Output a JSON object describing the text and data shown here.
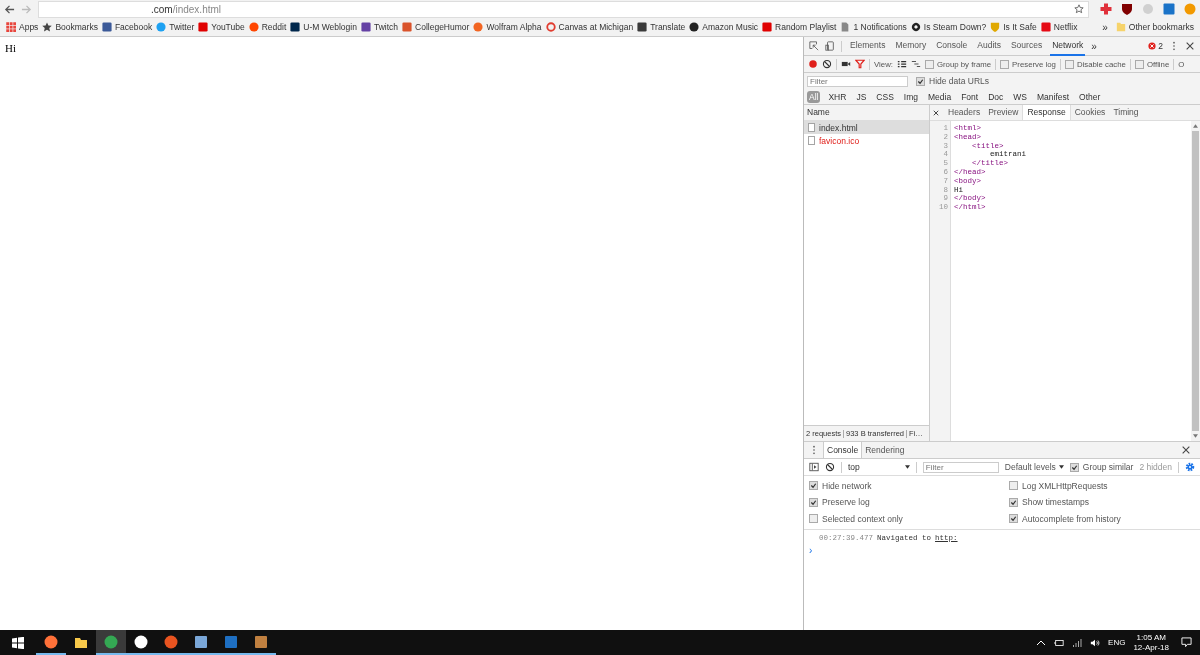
{
  "browser": {
    "address": {
      "host": ".com",
      "path": "/index.html"
    },
    "extensions": [
      {
        "kind": "cross",
        "color": "#e0303a"
      },
      {
        "kind": "shield",
        "color": "#800000"
      },
      {
        "kind": "gear",
        "color": "#d0d0d0"
      },
      {
        "kind": "square",
        "color": "#1a73c8"
      },
      {
        "kind": "circle",
        "color": "#f29900"
      }
    ],
    "bookmarks": [
      {
        "label": "Apps",
        "kind": "grid",
        "color": "#e8453c"
      },
      {
        "label": "Bookmarks",
        "kind": "star",
        "color": "#444444"
      },
      {
        "label": "Facebook",
        "kind": "square",
        "color": "#3b5998"
      },
      {
        "label": "Twitter",
        "kind": "circle",
        "color": "#1da1f2"
      },
      {
        "label": "YouTube",
        "kind": "square",
        "color": "#e00000"
      },
      {
        "label": "Reddit",
        "kind": "circle",
        "color": "#ff4500"
      },
      {
        "label": "U-M Weblogin",
        "kind": "square",
        "color": "#00274c"
      },
      {
        "label": "Twitch",
        "kind": "square",
        "color": "#6441a4"
      },
      {
        "label": "CollegeHumor",
        "kind": "square",
        "color": "#d9532b"
      },
      {
        "label": "Wolfram Alpha",
        "kind": "circle",
        "color": "#f26522"
      },
      {
        "label": "Canvas at Michigan",
        "kind": "ring",
        "color": "#e13c2f"
      },
      {
        "label": "Translate",
        "kind": "square",
        "color": "#3a3a3a"
      },
      {
        "label": "Amazon Music",
        "kind": "circle",
        "color": "#222222"
      },
      {
        "label": "Random Playlist",
        "kind": "square",
        "color": "#e00000"
      },
      {
        "label": "1 Notifications",
        "kind": "page",
        "color": "#888888"
      },
      {
        "label": "Is Steam Down?",
        "kind": "gear",
        "color": "#222222"
      },
      {
        "label": "Is It Safe",
        "kind": "shield",
        "color": "#e0a800"
      },
      {
        "label": "Netflix",
        "kind": "square",
        "color": "#e50914"
      }
    ],
    "overflow": "»",
    "other": "Other bookmarks"
  },
  "page": {
    "text": "Hi"
  },
  "devtools": {
    "tabs": [
      {
        "label": "Elements",
        "selected": false
      },
      {
        "label": "Memory",
        "selected": false
      },
      {
        "label": "Console",
        "selected": false
      },
      {
        "label": "Audits",
        "selected": false
      },
      {
        "label": "Sources",
        "selected": false
      },
      {
        "label": "Network",
        "selected": true
      }
    ],
    "more": "»",
    "errors": "2",
    "toolbar": {
      "recording": true,
      "filter_active": true,
      "view_label": "View:",
      "options": [
        {
          "label": "Group by frame",
          "checked": false
        },
        {
          "label": "Preserve log",
          "checked": false
        },
        {
          "label": "Disable cache",
          "checked": false
        },
        {
          "label": "Offline",
          "checked": false
        }
      ],
      "throttle": "O"
    },
    "filter": {
      "placeholder": "Filter",
      "hide_data_urls": {
        "label": "Hide data URLs",
        "checked": true
      }
    },
    "types": [
      {
        "label": "All",
        "selected": true
      },
      {
        "label": "XHR",
        "selected": false
      },
      {
        "label": "JS",
        "selected": false
      },
      {
        "label": "CSS",
        "selected": false
      },
      {
        "label": "Img",
        "selected": false
      },
      {
        "label": "Media",
        "selected": false
      },
      {
        "label": "Font",
        "selected": false
      },
      {
        "label": "Doc",
        "selected": false
      },
      {
        "label": "WS",
        "selected": false
      },
      {
        "label": "Manifest",
        "selected": false
      },
      {
        "label": "Other",
        "selected": false
      }
    ],
    "name_header": "Name",
    "requests": [
      {
        "name": "index.html",
        "selected": true,
        "failed": false
      },
      {
        "name": "favicon.ico",
        "selected": false,
        "failed": true
      }
    ],
    "detail_tabs": [
      {
        "label": "Headers",
        "selected": false
      },
      {
        "label": "Preview",
        "selected": false
      },
      {
        "label": "Response",
        "selected": true
      },
      {
        "label": "Cookies",
        "selected": false
      },
      {
        "label": "Timing",
        "selected": false
      }
    ],
    "code": [
      {
        "number": "1",
        "text": "<html>",
        "kind": "tag"
      },
      {
        "number": "2",
        "text": "<head>",
        "kind": "tag"
      },
      {
        "number": "3",
        "text": "    <title>",
        "kind": "tag"
      },
      {
        "number": "4",
        "text": "        emitrani",
        "kind": "text"
      },
      {
        "number": "5",
        "text": "    </title>",
        "kind": "tag"
      },
      {
        "number": "6",
        "text": "</head>",
        "kind": "tag"
      },
      {
        "number": "7",
        "text": "<body>",
        "kind": "tag"
      },
      {
        "number": "8",
        "text": "Hi",
        "kind": "text"
      },
      {
        "number": "9",
        "text": "</body>",
        "kind": "tag"
      },
      {
        "number": "10",
        "text": "</html>",
        "kind": "tag"
      }
    ],
    "status": [
      "2 requests",
      "933 B transferred",
      "Fi…"
    ],
    "drawer": {
      "tabs": [
        {
          "label": "Console",
          "selected": true
        },
        {
          "label": "Rendering",
          "selected": false
        }
      ],
      "context": "top",
      "filter_placeholder": "Filter",
      "levels": "Default levels",
      "group_similar": {
        "label": "Group similar",
        "checked": true
      },
      "hidden": "2 hidden",
      "settings": [
        {
          "label": "Hide network",
          "checked": true
        },
        {
          "label": "Log XMLHttpRequests",
          "checked": false
        },
        {
          "label": "Preserve log",
          "checked": true
        },
        {
          "label": "Show timestamps",
          "checked": true
        },
        {
          "label": "Selected context only",
          "checked": false
        },
        {
          "label": "Autocomplete from history",
          "checked": true
        }
      ],
      "messages": [
        {
          "time": "00:27:39.477",
          "text": "Navigated to",
          "link": "http:"
        }
      ],
      "prompt": "›"
    }
  },
  "taskbar": {
    "apps": [
      {
        "kind": "circle",
        "color": "#ff7139",
        "active": false,
        "running": true
      },
      {
        "kind": "folder",
        "color": "#f8c94a",
        "active": false,
        "running": false
      },
      {
        "kind": "circle",
        "color": "#34a853",
        "active": true,
        "running": true
      },
      {
        "kind": "circle",
        "color": "#ffffff",
        "active": false,
        "running": true
      },
      {
        "kind": "circle",
        "color": "#e95420",
        "active": false,
        "running": true
      },
      {
        "kind": "square",
        "color": "#7aa7d8",
        "active": false,
        "running": true
      },
      {
        "kind": "square",
        "color": "#1e6fc2",
        "active": false,
        "running": true
      },
      {
        "kind": "square",
        "color": "#c08040",
        "active": false,
        "running": true
      }
    ],
    "language": "ENG",
    "time": "1:05 AM",
    "date": "12-Apr-18"
  }
}
